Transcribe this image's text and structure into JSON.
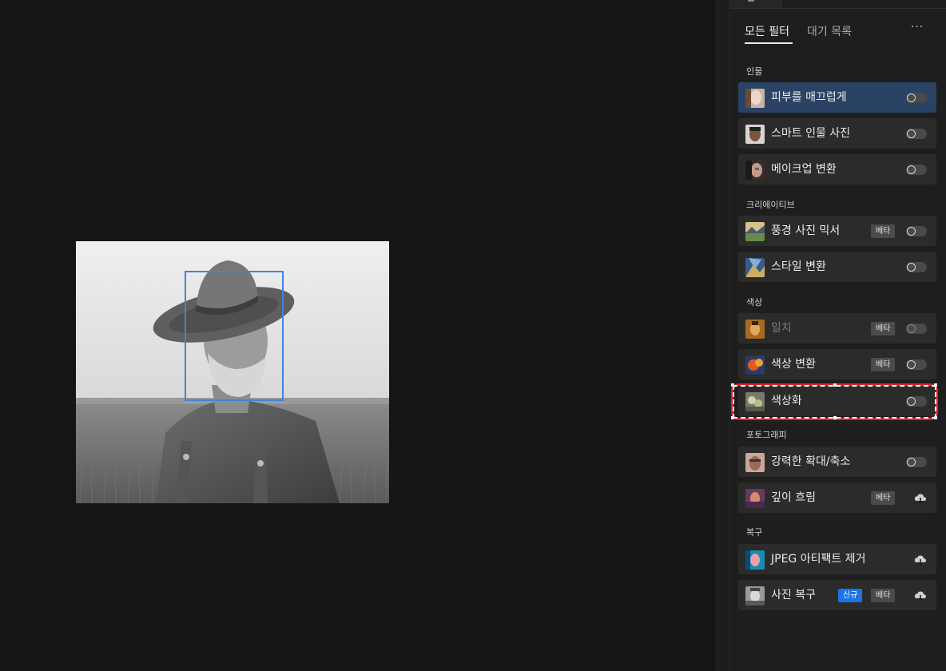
{
  "tabs": {
    "all_filters": "모든 필터",
    "wait_list": "대기 목록",
    "more": "···"
  },
  "sections": {
    "portrait": "인물",
    "creative": "크리에이티브",
    "color": "색상",
    "photography": "포토그래피",
    "restoration": "복구"
  },
  "filters": {
    "skin_smoothing": {
      "label": "피부를 매끄럽게",
      "enabled": false,
      "active": true
    },
    "smart_portrait": {
      "label": "스마트 인물 사진",
      "enabled": false
    },
    "makeup_transfer": {
      "label": "메이크업 변환",
      "enabled": false
    },
    "landscape_mixer": {
      "label": "풍경 사진 믹서",
      "badge": "베타",
      "enabled": false
    },
    "style_transfer": {
      "label": "스타일 변환",
      "enabled": false
    },
    "harmonization": {
      "label": "일치",
      "badge": "베타",
      "enabled": false,
      "disabled": true
    },
    "color_transfer": {
      "label": "색상 변환",
      "badge": "베타",
      "enabled": false
    },
    "colorize": {
      "label": "색상화",
      "enabled": false,
      "highlighted": true
    },
    "super_zoom": {
      "label": "강력한 확대/축소",
      "enabled": false
    },
    "depth_blur": {
      "label": "깊이 흐림",
      "badge": "베타",
      "download": "cloud-download-icon"
    },
    "jpeg_artifacts_removal": {
      "label": "JPEG 아티팩트 제거",
      "download": "cloud-download-icon"
    },
    "photo_restoration": {
      "label": "사진 복구",
      "badge_new": "신규",
      "badge": "베타",
      "download": "cloud-download-icon"
    }
  },
  "colors": {
    "active_row": "#2a4365",
    "face_box": "#3d84e0",
    "new_badge": "#1a73e8",
    "highlight": "#e0202a"
  }
}
